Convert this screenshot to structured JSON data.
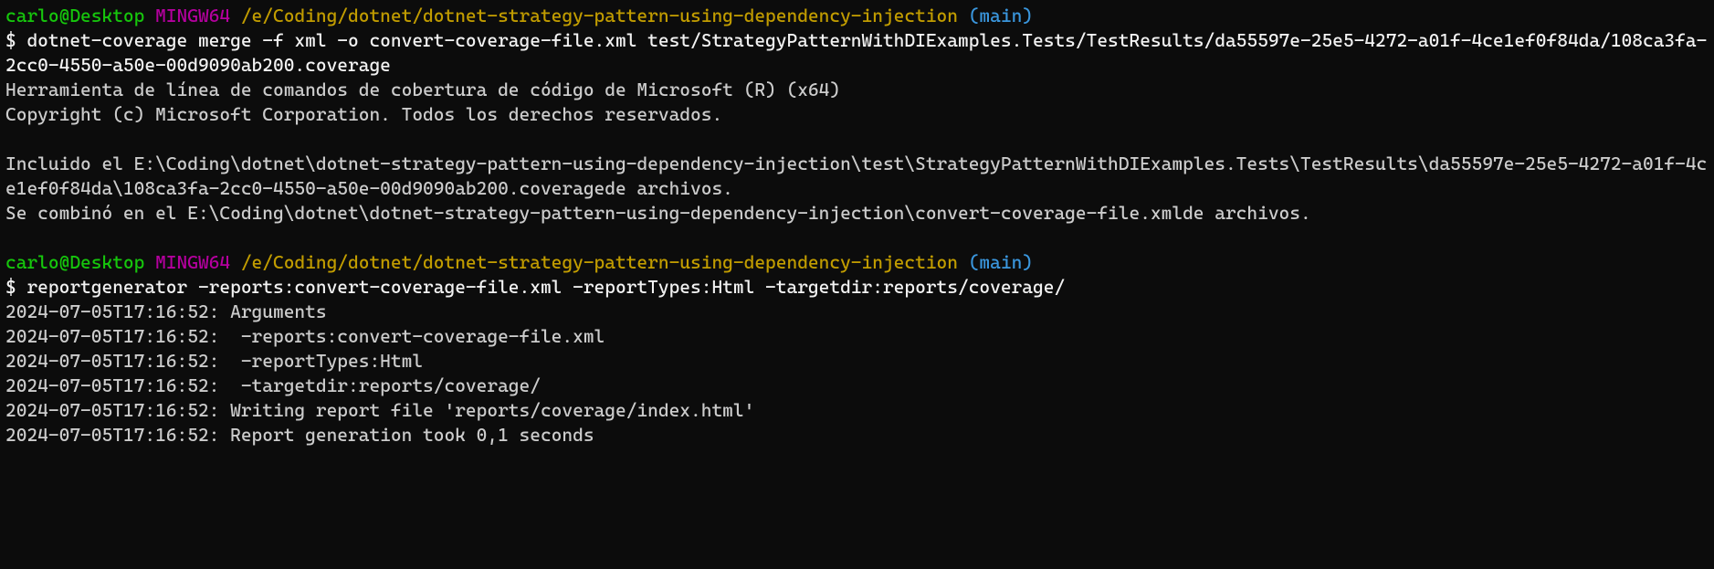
{
  "prompt1": {
    "user": "carlo@Desktop",
    "env": "MINGW64",
    "path": "/e/Coding/dotnet/dotnet-strategy-pattern-using-dependency-injection",
    "branch": "(main)",
    "symbol": "$"
  },
  "command1": "dotnet-coverage merge -f xml -o convert-coverage-file.xml test/StrategyPatternWithDIExamples.Tests/TestResults/da55597e-25e5-4272-a01f-4ce1ef0f84da/108ca3fa-2cc0-4550-a50e-00d9090ab200.coverage",
  "output1": "Herramienta de línea de comandos de cobertura de código de Microsoft (R) (x64)\nCopyright (c) Microsoft Corporation. Todos los derechos reservados.\n\nIncluido el E:\\Coding\\dotnet\\dotnet-strategy-pattern-using-dependency-injection\\test\\StrategyPatternWithDIExamples.Tests\\TestResults\\da55597e-25e5-4272-a01f-4ce1ef0f84da\\108ca3fa-2cc0-4550-a50e-00d9090ab200.coveragede archivos.\nSe combinó en el E:\\Coding\\dotnet\\dotnet-strategy-pattern-using-dependency-injection\\convert-coverage-file.xmlde archivos.",
  "prompt2": {
    "user": "carlo@Desktop",
    "env": "MINGW64",
    "path": "/e/Coding/dotnet/dotnet-strategy-pattern-using-dependency-injection",
    "branch": "(main)",
    "symbol": "$"
  },
  "command2": "reportgenerator -reports:convert-coverage-file.xml -reportTypes:Html -targetdir:reports/coverage/",
  "output2": "2024-07-05T17:16:52: Arguments\n2024-07-05T17:16:52:  -reports:convert-coverage-file.xml\n2024-07-05T17:16:52:  -reportTypes:Html\n2024-07-05T17:16:52:  -targetdir:reports/coverage/\n2024-07-05T17:16:52: Writing report file 'reports/coverage/index.html'\n2024-07-05T17:16:52: Report generation took 0,1 seconds"
}
